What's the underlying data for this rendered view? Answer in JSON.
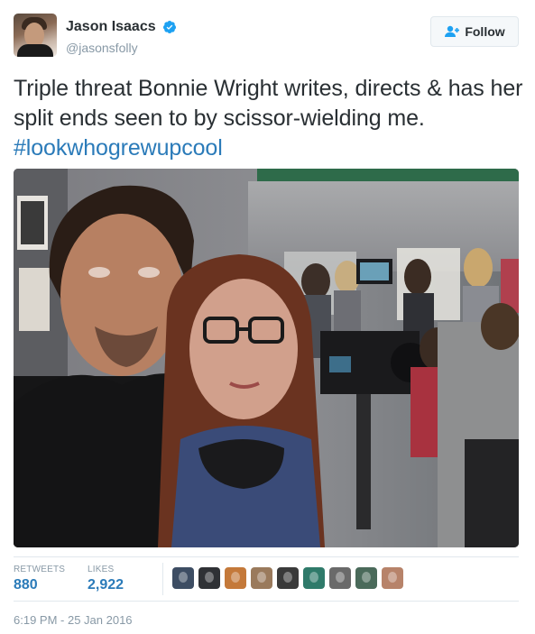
{
  "user": {
    "display_name": "Jason Isaacs",
    "handle": "@jasonsfolly",
    "avatar_icon": "profile-photo",
    "verified_icon": "verified-badge-icon"
  },
  "follow_button": {
    "label": "Follow",
    "icon": "add-user-icon"
  },
  "tweet": {
    "text": "Triple threat Bonnie Wright writes, directs & has her split ends seen to by scissor-wielding me.",
    "hashtag": "#lookwhogrewupcool"
  },
  "stats": {
    "retweets_label": "RETWEETS",
    "retweets_value": "880",
    "likes_label": "LIKES",
    "likes_value": "2,922"
  },
  "likers": [
    {
      "color": "#3d4d63"
    },
    {
      "color": "#2f3135"
    },
    {
      "color": "#c4793a"
    },
    {
      "color": "#9a7a5c"
    },
    {
      "color": "#3a3a3a"
    },
    {
      "color": "#2f7a6a"
    },
    {
      "color": "#6a6a6a"
    },
    {
      "color": "#4a6a5a"
    },
    {
      "color": "#b7836a"
    }
  ],
  "timestamp": "6:19 PM - 25 Jan 2016",
  "colors": {
    "link": "#2b7bb9",
    "text": "#292f33",
    "muted": "#8899a6",
    "verified": "#1da1f2"
  }
}
